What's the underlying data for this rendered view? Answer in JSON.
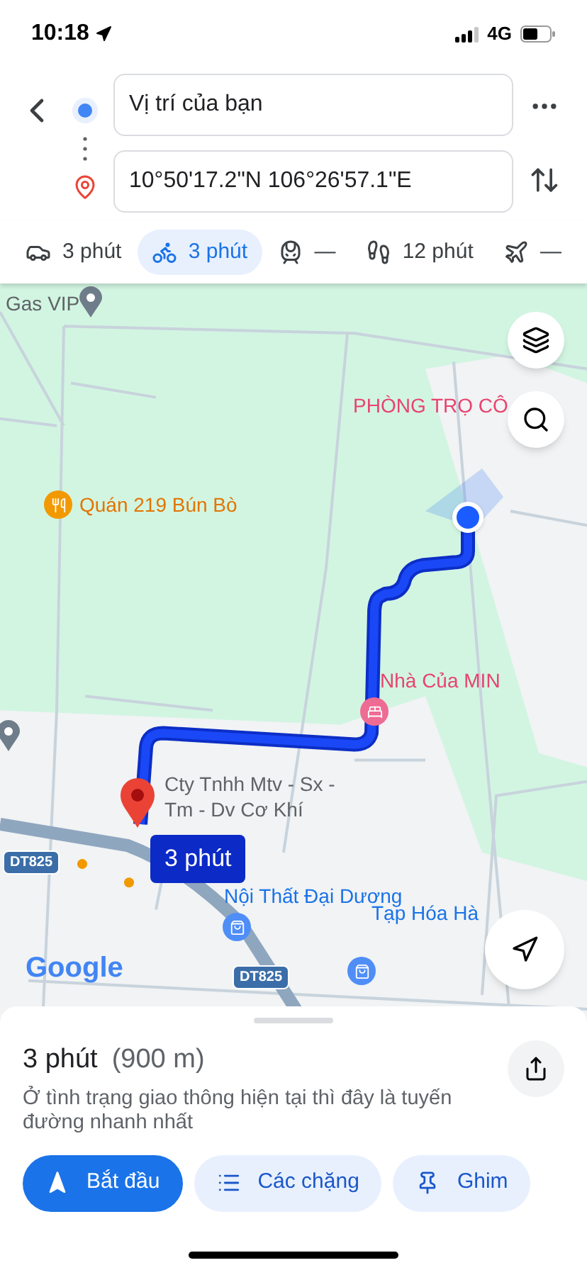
{
  "status_bar": {
    "time": "10:18",
    "network": "4G"
  },
  "route": {
    "origin": {
      "value": "Vị trí của bạn"
    },
    "destination": {
      "value": "10°50'17.2\"N 106°26'57.1\"E"
    }
  },
  "modes": [
    {
      "kind": "car",
      "label": "3 phút",
      "selected": false
    },
    {
      "kind": "motorbike",
      "label": "3 phút",
      "selected": true
    },
    {
      "kind": "transit",
      "label": "—",
      "selected": false
    },
    {
      "kind": "walk",
      "label": "12 phút",
      "selected": false
    },
    {
      "kind": "flight",
      "label": "—",
      "selected": false
    }
  ],
  "map": {
    "places": [
      {
        "kind": "gray",
        "label": "Gas VIP"
      },
      {
        "kind": "pink",
        "label": "PHÒNG TRỌ CÔ"
      },
      {
        "kind": "food",
        "label": "Quán 219 Bún Bò"
      },
      {
        "kind": "hotel",
        "label": "Nhà Của MIN"
      },
      {
        "kind": "dest",
        "label": "Cty Tnhh Mtv - Sx - Tm - Dv Cơ Khí"
      },
      {
        "kind": "shop",
        "label": "Nội Thất Đại Dương"
      },
      {
        "kind": "shop2",
        "label": "Tạp Hóa Hà"
      }
    ],
    "roads": [
      "DT825",
      "DT825"
    ],
    "route_label": "3 phút",
    "logo": "Google"
  },
  "sheet": {
    "duration": "3 phút",
    "distance": "(900 m)",
    "note": "Ở tình trạng giao thông hiện tại thì đây là tuyến đường nhanh nhất",
    "actions": [
      {
        "kind": "start",
        "label": "Bắt đầu"
      },
      {
        "kind": "steps",
        "label": "Các chặng"
      },
      {
        "kind": "pin",
        "label": "Ghim"
      }
    ]
  }
}
